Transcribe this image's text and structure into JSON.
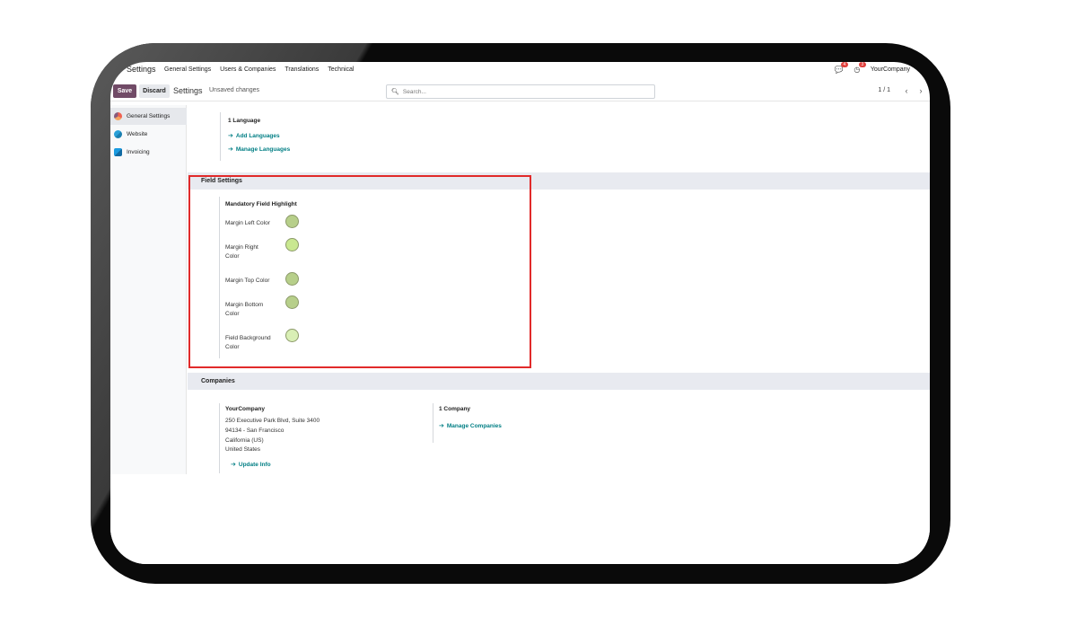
{
  "navbar": {
    "brand": "Settings",
    "menu": [
      "General Settings",
      "Users & Companies",
      "Translations",
      "Technical"
    ],
    "chat_badge": "4",
    "activity_badge": "3",
    "company": "YourCompany"
  },
  "control": {
    "save_label": "Save",
    "discard_label": "Discard",
    "title": "Settings",
    "unsaved": "Unsaved changes",
    "search_placeholder": "Search...",
    "pager": "1 / 1"
  },
  "sidebar": {
    "items": [
      {
        "label": "General Settings"
      },
      {
        "label": "Website"
      },
      {
        "label": "Invoicing"
      }
    ]
  },
  "languages": {
    "count": "1 Language",
    "add": "Add Languages",
    "manage": "Manage Languages"
  },
  "field_settings": {
    "header": "Field Settings",
    "title": "Mandatory Field Highlight",
    "colors": [
      {
        "label": "Margin Left Color",
        "color": "#b7cf8a"
      },
      {
        "label": "Margin Right Color",
        "color": "#c9e890"
      },
      {
        "label": "Margin Top Color",
        "color": "#b7cf8a"
      },
      {
        "label": "Margin Bottom Color",
        "color": "#b7cf8a"
      },
      {
        "label": "Field Background Color",
        "color": "#d9efb5"
      }
    ]
  },
  "companies": {
    "header": "Companies",
    "name": "YourCompany",
    "address_line1": "250 Executive Park Blvd, Suite 3400",
    "address_line2": "94134 - San Francisco",
    "address_line3": "California (US)",
    "address_line4": "United States",
    "update": "Update Info",
    "count": "1 Company",
    "manage": "Manage Companies"
  },
  "colors": {
    "brand": "#714b67",
    "link": "#017e84",
    "highlight": "#e12a2a"
  }
}
